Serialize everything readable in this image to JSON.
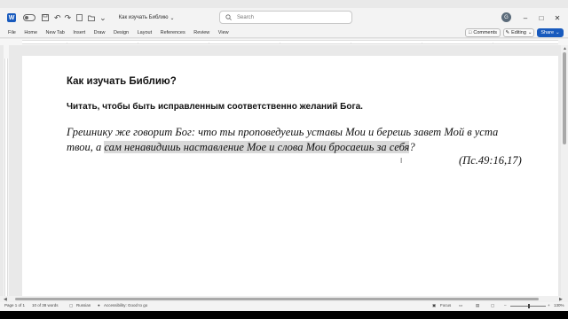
{
  "titlebar": {
    "app_logo": "W",
    "doc_title": "Как изучать Библию",
    "search_placeholder": "Search",
    "avatar_initial": "G",
    "icons": [
      "word-icon",
      "autosave-toggle",
      "save-icon",
      "undo-icon",
      "redo-icon",
      "page-icon",
      "folder-icon",
      "more-icon"
    ]
  },
  "menu": {
    "items": [
      "File",
      "Home",
      "New Tab",
      "Insert",
      "Draw",
      "Design",
      "Layout",
      "References",
      "Review",
      "View"
    ],
    "comments_label": "Comments",
    "editing_label": "Editing",
    "share_label": "Share"
  },
  "document": {
    "heading": "Как изучать Библию?",
    "subheading": "Читать, чтобы быть исправленным соответственно желаний Бога.",
    "quote_plain": "Грешнику же говорит Бог: что ты проповедуешь уставы Мои и берешь завет Мой в уста твои, а ",
    "quote_selected": "сам ненавидишь наставление Мое и слова Мои бросаешь за себя",
    "quote_end": "?",
    "reference": "(Пс.49:16,17)"
  },
  "status": {
    "page": "Page 1 of 1",
    "words": "10 of 38 words",
    "language": "Russian",
    "accessibility": "Accessibility: Good to go",
    "focus": "Focus",
    "zoom": "130%"
  }
}
